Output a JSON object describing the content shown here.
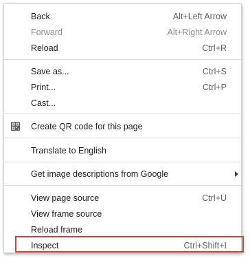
{
  "menu": {
    "back": {
      "label": "Back",
      "shortcut": "Alt+Left Arrow"
    },
    "forward": {
      "label": "Forward",
      "shortcut": "Alt+Right Arrow"
    },
    "reload": {
      "label": "Reload",
      "shortcut": "Ctrl+R"
    },
    "save_as": {
      "label": "Save as...",
      "shortcut": "Ctrl+S"
    },
    "print": {
      "label": "Print...",
      "shortcut": "Ctrl+P"
    },
    "cast": {
      "label": "Cast..."
    },
    "qr_code": {
      "label": "Create QR code for this page",
      "icon": "qr-code-icon"
    },
    "translate": {
      "label": "Translate to English"
    },
    "image_descriptions": {
      "label": "Get image descriptions from Google",
      "icon": "chevron-right-icon"
    },
    "view_source": {
      "label": "View page source",
      "shortcut": "Ctrl+U"
    },
    "view_frame_source": {
      "label": "View frame source"
    },
    "reload_frame": {
      "label": "Reload frame"
    },
    "inspect": {
      "label": "Inspect",
      "shortcut": "Ctrl+Shift+I"
    }
  },
  "colors": {
    "highlight_border": "#e53935",
    "text": "#202124",
    "disabled_text": "#8a8d91"
  }
}
